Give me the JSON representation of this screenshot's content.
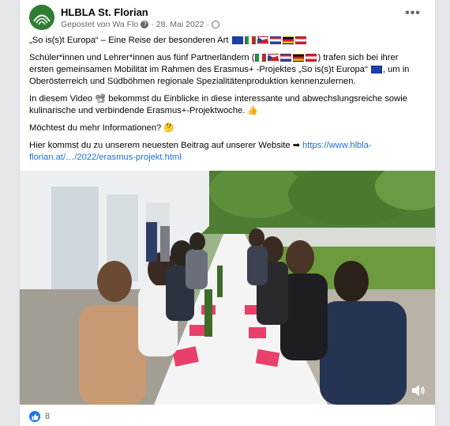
{
  "post": {
    "page_name": "HLBLA St. Florian",
    "posted_via": "Gepostet von Wa Flo",
    "date": "28. Mai 2022",
    "more_label": "•••"
  },
  "text": {
    "p1": "„So is(s)t Europa“ – Eine Reise der besonderen Art",
    "p2a": "Schüler*innen und Lehrer*innen aus fünf Partnerländern (",
    "p2b": ") trafen sich bei ihrer ersten gemeinsamen Mobilität im Rahmen des Erasmus+ -Projektes „So is(s)t Europa“",
    "p2c": ", um in Oberösterreich und Südböhmen regionale Spezialitätenproduktion kennenzulernen.",
    "p3a": "In diesem Video",
    "p3b": "bekommst du Einblicke in diese interessante und abwechslungsreiche sowie kulinarische und verbindende Erasmus+-Projektwoche.",
    "p4": "Möchtest du mehr Informationen?",
    "p5": "Hier kommst du zu unserem neuesten Beitrag auf unserer Website",
    "link": "https://www.hlbla-florian.at/…/2022/erasmus-projekt.html"
  },
  "reactions": {
    "count": "8"
  },
  "icons": {
    "like": "like-icon",
    "volume": "volume-icon",
    "arrow": "right-arrow-emoji"
  },
  "colors": {
    "link": "#216fdb",
    "like": "#1877f2",
    "meta": "#65676b"
  }
}
